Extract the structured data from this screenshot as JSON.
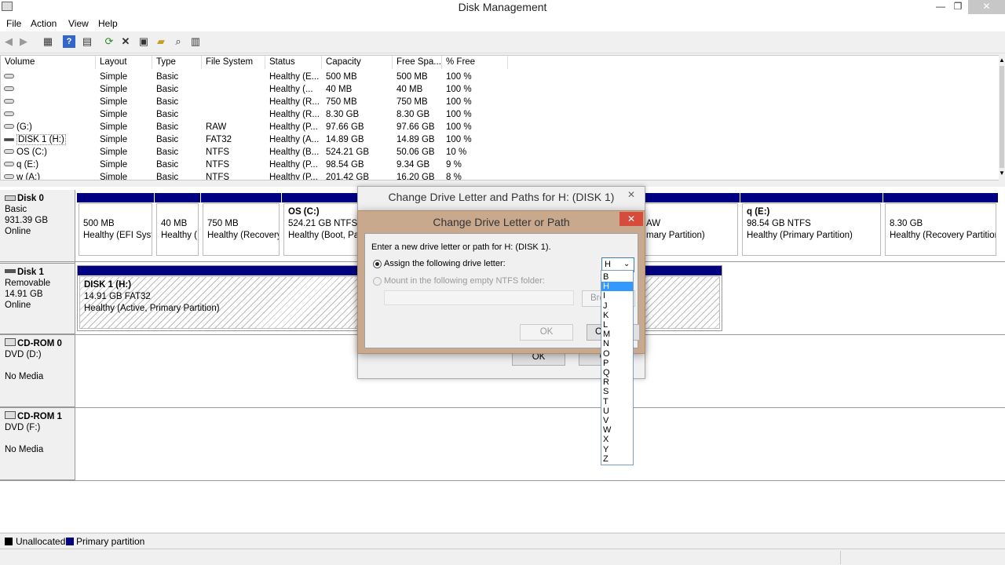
{
  "window": {
    "title": "Disk Management",
    "min": "—",
    "max": "❐",
    "close": "✕"
  },
  "menu": [
    "File",
    "Action",
    "View",
    "Help"
  ],
  "volume_table": {
    "headers": [
      "Volume",
      "Layout",
      "Type",
      "File System",
      "Status",
      "Capacity",
      "Free Spa...",
      "% Free"
    ],
    "rows": [
      {
        "volume": "",
        "layout": "Simple",
        "type": "Basic",
        "fs": "",
        "status": "Healthy (E...",
        "capacity": "500 MB",
        "free": "500 MB",
        "pct": "100 %"
      },
      {
        "volume": "",
        "layout": "Simple",
        "type": "Basic",
        "fs": "",
        "status": "Healthy (...",
        "capacity": "40 MB",
        "free": "40 MB",
        "pct": "100 %"
      },
      {
        "volume": "",
        "layout": "Simple",
        "type": "Basic",
        "fs": "",
        "status": "Healthy (R...",
        "capacity": "750 MB",
        "free": "750 MB",
        "pct": "100 %"
      },
      {
        "volume": "",
        "layout": "Simple",
        "type": "Basic",
        "fs": "",
        "status": "Healthy (R...",
        "capacity": "8.30 GB",
        "free": "8.30 GB",
        "pct": "100 %"
      },
      {
        "volume": "(G:)",
        "layout": "Simple",
        "type": "Basic",
        "fs": "RAW",
        "status": "Healthy (P...",
        "capacity": "97.66 GB",
        "free": "97.66 GB",
        "pct": "100 %"
      },
      {
        "volume": "DISK 1 (H:)",
        "layout": "Simple",
        "type": "Basic",
        "fs": "FAT32",
        "status": "Healthy (A...",
        "capacity": "14.89 GB",
        "free": "14.89 GB",
        "pct": "100 %"
      },
      {
        "volume": "OS (C:)",
        "layout": "Simple",
        "type": "Basic",
        "fs": "NTFS",
        "status": "Healthy (B...",
        "capacity": "524.21 GB",
        "free": "50.06 GB",
        "pct": "10 %"
      },
      {
        "volume": "q (E:)",
        "layout": "Simple",
        "type": "Basic",
        "fs": "NTFS",
        "status": "Healthy (P...",
        "capacity": "98.54 GB",
        "free": "9.34 GB",
        "pct": "9 %"
      },
      {
        "volume": "w (A:)",
        "layout": "Simple",
        "type": "Basic",
        "fs": "NTFS",
        "status": "Healthy (P...",
        "capacity": "201.42 GB",
        "free": "16.20 GB",
        "pct": "8 %"
      }
    ]
  },
  "disks": {
    "disk0": {
      "name": "Disk 0",
      "kind": "Basic",
      "size": "931.39 GB",
      "state": "Online",
      "parts": [
        {
          "title": "",
          "l1": "500 MB",
          "l2": "Healthy (EFI Syste"
        },
        {
          "title": "",
          "l1": "40 MB",
          "l2": "Healthy ("
        },
        {
          "title": "",
          "l1": "750 MB",
          "l2": "Healthy (Recovery"
        },
        {
          "title": "OS  (C:)",
          "l1": "524.21 GB NTFS",
          "l2": "Healthy (Boot, Pa"
        },
        {
          "title": "",
          "l1": "AW",
          "l2": "mary Partition)"
        },
        {
          "title": "q  (E:)",
          "l1": "98.54 GB NTFS",
          "l2": "Healthy (Primary Partition)"
        },
        {
          "title": "",
          "l1": "8.30 GB",
          "l2": "Healthy (Recovery Partition"
        }
      ]
    },
    "disk1": {
      "name": "Disk 1",
      "kind": "Removable",
      "size": "14.91 GB",
      "state": "Online",
      "part": {
        "title": "DISK 1  (H:)",
        "l1": "14.91 GB FAT32",
        "l2": "Healthy (Active, Primary Partition)"
      }
    },
    "cdrom0": {
      "name": "CD-ROM 0",
      "kind": "DVD (D:)",
      "state": "No Media"
    },
    "cdrom1": {
      "name": "CD-ROM 1",
      "kind": "DVD (F:)",
      "state": "No Media"
    }
  },
  "legend": {
    "unallocated": "Unallocated",
    "primary": "Primary partition",
    "primary_color": "#000080"
  },
  "dialog_paths": {
    "title": "Change Drive Letter and Paths for H: (DISK 1)",
    "ok": "OK",
    "cancel": "Ca"
  },
  "dialog_letter": {
    "title": "Change Drive Letter or Path",
    "prompt": "Enter a new drive letter or path for H: (DISK 1).",
    "assign_label": "Assign the following drive letter:",
    "mount_label": "Mount in the following empty NTFS folder:",
    "browse": "Bro",
    "ok": "OK",
    "cancel": "Ca",
    "selected_letter": "H",
    "accent": "#c9a98d",
    "options": [
      "B",
      "H",
      "I",
      "J",
      "K",
      "L",
      "M",
      "N",
      "O",
      "P",
      "Q",
      "R",
      "S",
      "T",
      "U",
      "V",
      "W",
      "X",
      "Y",
      "Z"
    ]
  }
}
